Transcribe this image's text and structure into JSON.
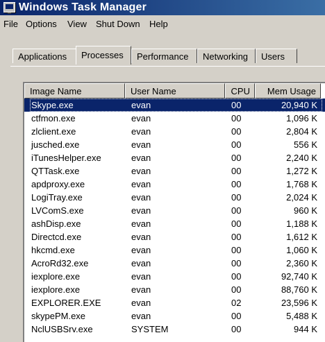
{
  "window": {
    "title": "Windows Task Manager",
    "icon": "task-manager-icon"
  },
  "menu": [
    "File",
    "Options",
    "View",
    "Shut Down",
    "Help"
  ],
  "tabs": [
    {
      "label": "Applications",
      "active": false
    },
    {
      "label": "Processes",
      "active": true
    },
    {
      "label": "Performance",
      "active": false
    },
    {
      "label": "Networking",
      "active": false
    },
    {
      "label": "Users",
      "active": false
    }
  ],
  "columns": {
    "name": "Image Name",
    "user": "User Name",
    "cpu": "CPU",
    "mem": "Mem Usage"
  },
  "processes": [
    {
      "name": "Skype.exe",
      "user": "evan",
      "cpu": "00",
      "mem": "20,940 K",
      "selected": true
    },
    {
      "name": "ctfmon.exe",
      "user": "evan",
      "cpu": "00",
      "mem": "1,096 K"
    },
    {
      "name": "zlclient.exe",
      "user": "evan",
      "cpu": "00",
      "mem": "2,804 K"
    },
    {
      "name": "jusched.exe",
      "user": "evan",
      "cpu": "00",
      "mem": "556 K"
    },
    {
      "name": "iTunesHelper.exe",
      "user": "evan",
      "cpu": "00",
      "mem": "2,240 K"
    },
    {
      "name": "QTTask.exe",
      "user": "evan",
      "cpu": "00",
      "mem": "1,272 K"
    },
    {
      "name": "apdproxy.exe",
      "user": "evan",
      "cpu": "00",
      "mem": "1,768 K"
    },
    {
      "name": "LogiTray.exe",
      "user": "evan",
      "cpu": "00",
      "mem": "2,024 K"
    },
    {
      "name": "LVComS.exe",
      "user": "evan",
      "cpu": "00",
      "mem": "960 K"
    },
    {
      "name": "ashDisp.exe",
      "user": "evan",
      "cpu": "00",
      "mem": "1,188 K"
    },
    {
      "name": "Directcd.exe",
      "user": "evan",
      "cpu": "00",
      "mem": "1,612 K"
    },
    {
      "name": "hkcmd.exe",
      "user": "evan",
      "cpu": "00",
      "mem": "1,060 K"
    },
    {
      "name": "AcroRd32.exe",
      "user": "evan",
      "cpu": "00",
      "mem": "2,360 K"
    },
    {
      "name": "iexplore.exe",
      "user": "evan",
      "cpu": "00",
      "mem": "92,740 K"
    },
    {
      "name": "iexplore.exe",
      "user": "evan",
      "cpu": "00",
      "mem": "88,760 K"
    },
    {
      "name": "EXPLORER.EXE",
      "user": "evan",
      "cpu": "02",
      "mem": "23,596 K"
    },
    {
      "name": "skypePM.exe",
      "user": "evan",
      "cpu": "00",
      "mem": "5,488 K"
    },
    {
      "name": "NclUSBSrv.exe",
      "user": "SYSTEM",
      "cpu": "00",
      "mem": "944 K"
    }
  ],
  "colors": {
    "title_bar": "#0a246a",
    "selection": "#0a246a",
    "face": "#d4d0c8"
  }
}
